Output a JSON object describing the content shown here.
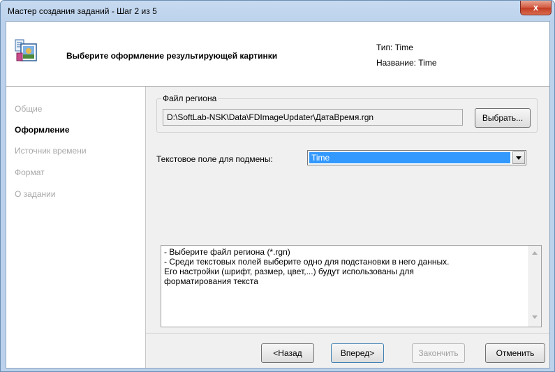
{
  "window": {
    "title": "Мастер создания заданий - Шаг 2 из 5",
    "close_glyph": "x"
  },
  "header": {
    "heading": "Выберите оформление результирующей картинки",
    "type_line": "Тип: Time",
    "name_line": "Название: Time",
    "icon": "wizard-image-icon"
  },
  "nav": {
    "items": [
      {
        "label": "Общие",
        "active": false
      },
      {
        "label": "Оформление",
        "active": true
      },
      {
        "label": "Источник времени",
        "active": false
      },
      {
        "label": "Формат",
        "active": false
      },
      {
        "label": "О задании",
        "active": false
      }
    ]
  },
  "region": {
    "legend": "Файл региона",
    "path": "D:\\SoftLab-NSK\\Data\\FDImageUpdater\\ДатаВремя.rgn",
    "browse_label": "Выбрать..."
  },
  "text_field": {
    "label": "Текстовое поле для подмены:",
    "selected": "Time"
  },
  "hint": {
    "text": "- Выберите файл региона (*.rgn)\n- Среди текстовых полей выберите одно для подстановки в него данных.\nЕго настройки (шрифт, размер, цвет,...) будут использованы для\nформатирования текста"
  },
  "buttons": {
    "back": "<Назад",
    "next": "Вперед>",
    "finish": "Закончить",
    "cancel": "Отменить"
  },
  "colors": {
    "selection": "#3399ff",
    "close": "#c23b22",
    "disabled_text": "#a0a0a0"
  }
}
